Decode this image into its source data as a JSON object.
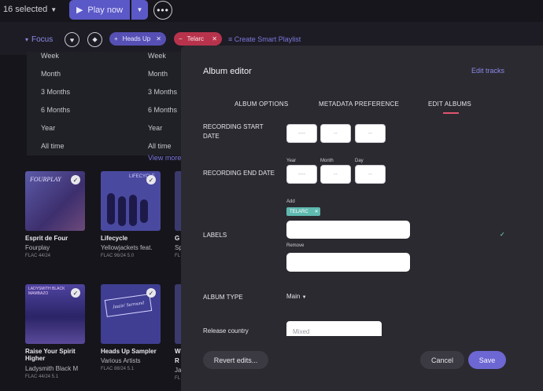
{
  "topbar": {
    "selected": "16 selected",
    "play": "Play now"
  },
  "focusbar": {
    "focus": "Focus",
    "chips": [
      {
        "label": "Heads Up"
      },
      {
        "label": "Telarc"
      }
    ],
    "create": "Create Smart Playlist"
  },
  "date_menu": {
    "left": [
      "Week",
      "Month",
      "3 Months",
      "6 Months",
      "Year",
      "All time"
    ],
    "right": [
      "Week",
      "Month",
      "3 Months",
      "6 Months",
      "Year",
      "All time"
    ],
    "view_more": "View more"
  },
  "albums": [
    {
      "cover_text": "FOURPLAY",
      "title": "Esprit de Four",
      "artist": "Fourplay",
      "format": "FLAC 44/24"
    },
    {
      "cover_text": "LIFECYCLE",
      "title": "Lifecycle",
      "artist": "Yellowjackets feat.",
      "format": "FLAC 96/24 5.0"
    },
    {
      "cover_text": "",
      "title": "G",
      "artist": "Sp",
      "format": "FL"
    },
    {
      "cover_text": "LADYSMITH BLACK MAMBAZO",
      "title": "Raise Your Spirit Higher",
      "artist": "Ladysmith Black M",
      "format": "FLAC 44/24 5.1"
    },
    {
      "cover_text": "Jazzin' Surround",
      "title": "Heads Up Sampler",
      "artist": "Various Artists",
      "format": "FLAC 88/24 5.1"
    },
    {
      "cover_text": "",
      "title": "W",
      "title2": "R",
      "artist": "Ja",
      "format": "FL"
    }
  ],
  "modal": {
    "title": "Album editor",
    "edit_tracks": "Edit tracks",
    "tabs": [
      "ALBUM OPTIONS",
      "METADATA PREFERENCE",
      "EDIT ALBUMS"
    ],
    "rec_start_label": "RECORDING START DATE",
    "rec_end_label": "RECORDING END DATE",
    "year_label": "Year",
    "month_label": "Month",
    "day_label": "Day",
    "year_ph": "----",
    "month_ph": "--",
    "day_ph": "--",
    "labels_label": "LABELS",
    "add_label": "Add",
    "tag": "TELARC",
    "remove_label": "Remove",
    "album_type_label": "ALBUM TYPE",
    "album_type_value": "Main",
    "country_label": "Release country",
    "country_ph": "Mixed",
    "revert": "Revert edits...",
    "cancel": "Cancel",
    "save": "Save"
  },
  "colors": {
    "accent": "#5b58c7",
    "telarc_chip": "#b7334c",
    "tag": "#5fbab0",
    "tab_underline": "#e05470"
  }
}
